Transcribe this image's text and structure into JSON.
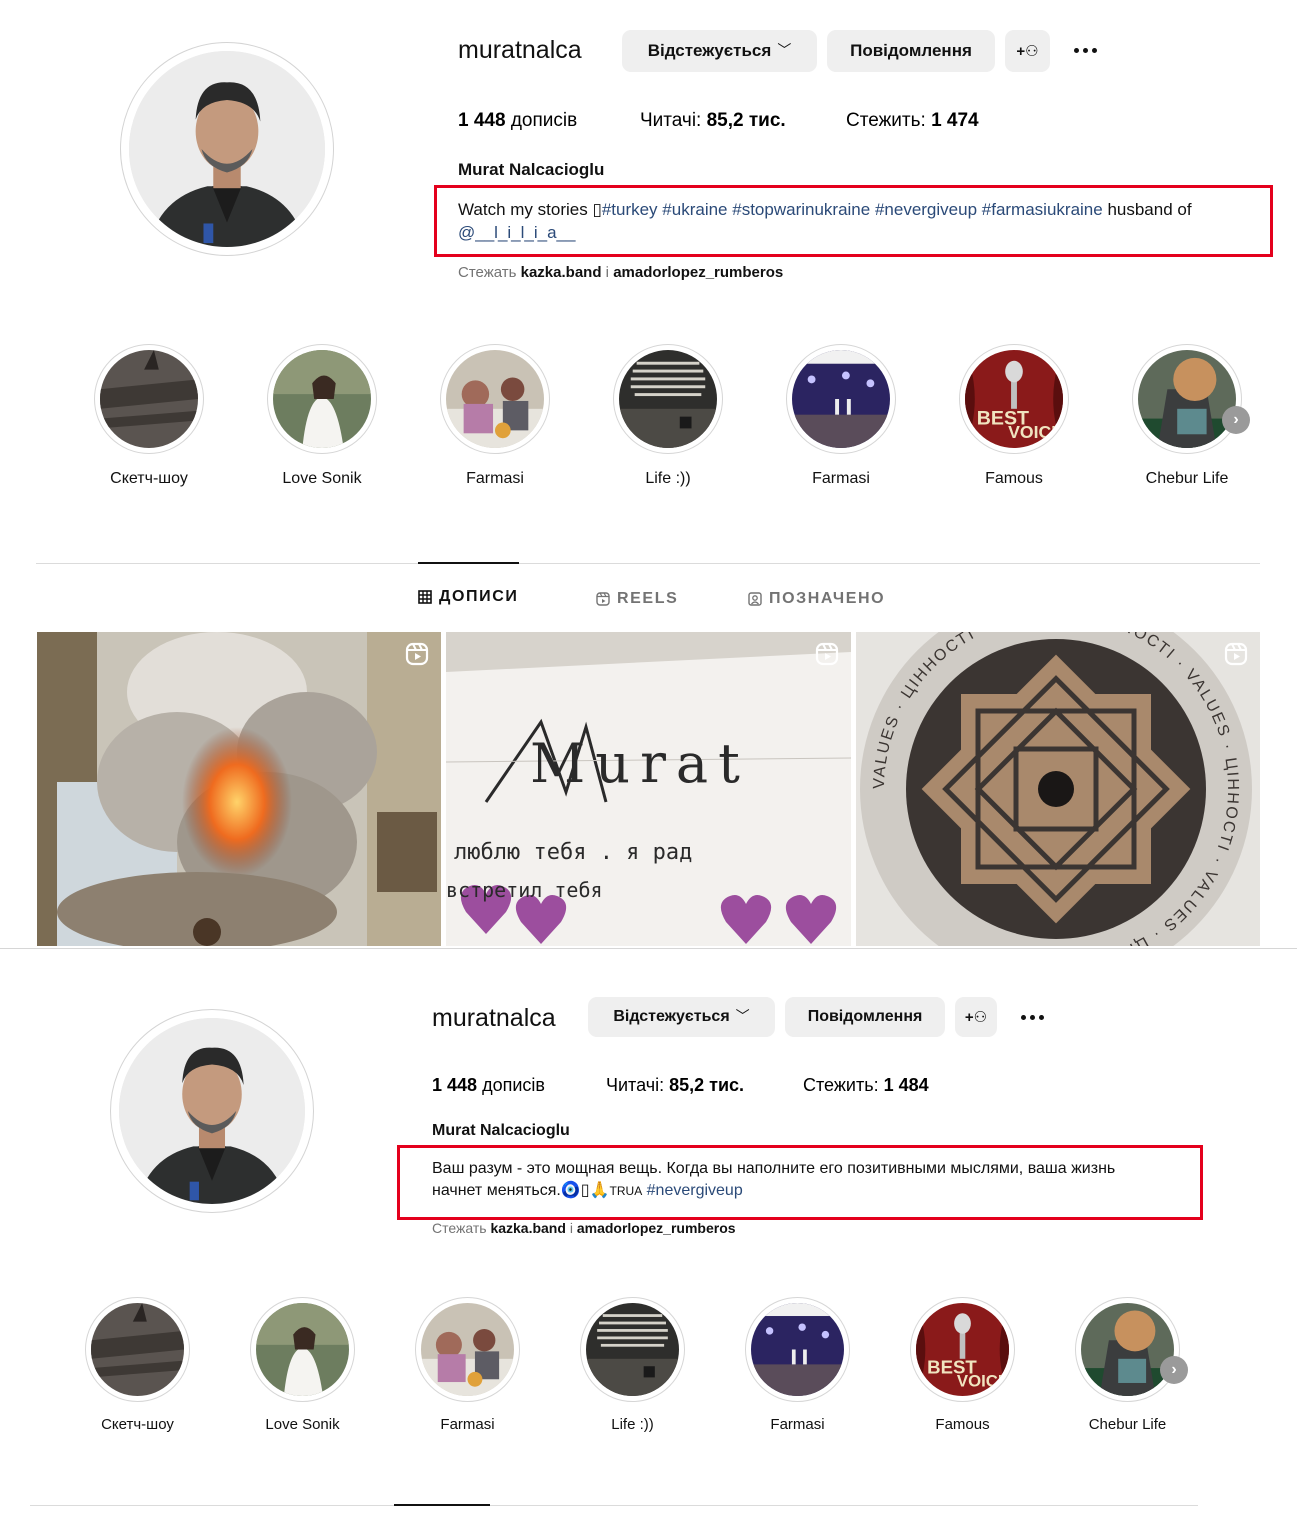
{
  "profile_a": {
    "username": "muratnalca",
    "follow_button": "Відстежується",
    "message_button": "Повідомлення",
    "add_user_icon": "person-plus-icon",
    "more_icon": "more-horizontal-icon",
    "stats": {
      "posts_count": "1 448",
      "posts_label": "дописів",
      "followers_label": "Читачі:",
      "followers_count": "85,2 тис.",
      "following_label": "Стежить:",
      "following_count": "1 474"
    },
    "full_name": "Murat Nalcacioglu",
    "bio": {
      "text1": "Watch my stories ",
      "glyph": "▯",
      "tag1": "#turkey",
      "tag2": "#ukraine",
      "tag3": "#stopwarinukraine",
      "tag4": "#nevergiveup",
      "tag5": "#farmasiukraine",
      "text2": " husband of",
      "mention": "@__l_i_l_i_a__"
    },
    "followed_by": {
      "prefix": "Стежать",
      "user1": "kazka.band",
      "sep": "і",
      "user2": "amadorlopez_rumberos"
    },
    "highlights": [
      {
        "label": "Скетч-шоу"
      },
      {
        "label": "Love Sonik"
      },
      {
        "label": "Farmasi"
      },
      {
        "label": "Life :))"
      },
      {
        "label": "Farmasi"
      },
      {
        "label": "Famous"
      },
      {
        "label": "Chebur Life"
      }
    ],
    "tabs": [
      {
        "label": "ДОПИСИ",
        "icon": "grid-icon"
      },
      {
        "label": "REELS",
        "icon": "reels-icon"
      },
      {
        "label": "ПОЗНАЧЕНО",
        "icon": "tagged-icon"
      }
    ],
    "posts": [
      {
        "label": "explosion"
      },
      {
        "handwriting_title": "Murat",
        "handwriting_line1": "люблю тебя . я рад",
        "handwriting_line2": "встретил тебя"
      },
      {
        "ring_text": "VALUES · ЦІННОСТІ · VALUES · ЦІННОСТІ · VALUES · ЦІННОСТІ · VALUES · ЦІННОСТІ ·"
      }
    ]
  },
  "profile_b": {
    "username": "muratnalca",
    "follow_button": "Відстежується",
    "message_button": "Повідомлення",
    "stats": {
      "posts_count": "1 448",
      "posts_label": "дописів",
      "followers_label": "Читачі:",
      "followers_count": "85,2 тис.",
      "following_label": "Стежить:",
      "following_count": "1 484"
    },
    "full_name": "Murat Nalcacioglu",
    "bio": {
      "line1": "Ваш разум - это мощная вещь. Когда вы наполните его позитивными мыслями, ваша жизнь",
      "line2": "начнет меняться.",
      "emojis": "🧿▯🙏",
      "small": "TRUA",
      "tag": "#nevergiveup"
    },
    "followed_by": {
      "prefix": "Стежать",
      "user1": "kazka.band",
      "sep": "і",
      "user2": "amadorlopez_rumberos"
    },
    "highlights": [
      {
        "label": "Скетч-шоу"
      },
      {
        "label": "Love Sonik"
      },
      {
        "label": "Farmasi"
      },
      {
        "label": "Life :))"
      },
      {
        "label": "Farmasi"
      },
      {
        "label": "Famous"
      },
      {
        "label": "Chebur Life"
      }
    ]
  },
  "colors": {
    "highlight_box": "#e4001c",
    "hashtag": "#2b4a78",
    "button_bg": "#efefef"
  }
}
